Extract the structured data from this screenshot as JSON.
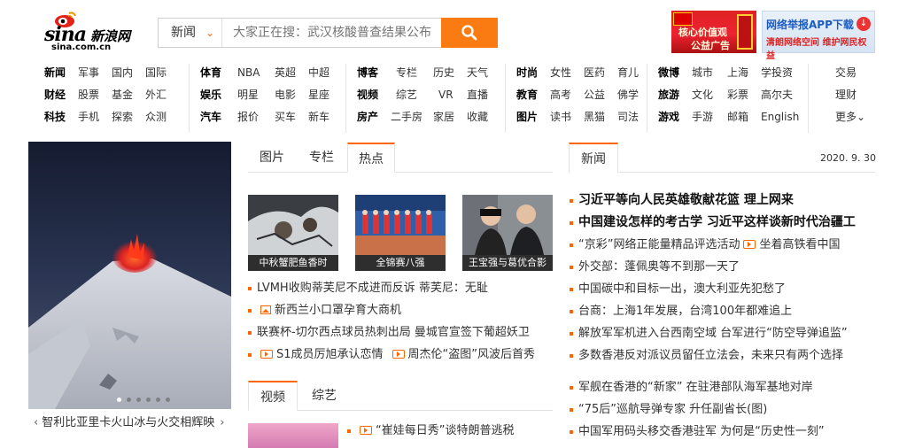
{
  "header": {
    "logo_text": "sina",
    "logo_cn": "新浪网",
    "logo_domain": "sina.com.cn",
    "search_category": "新闻",
    "search_placeholder": "大家正在搜：武汉核酸普查结果公布",
    "ad1_line1": "核心价值观",
    "ad1_line2": "公益广告",
    "ad2_line1": "网络举报APP下载",
    "ad2_line2": "清朗网络空间  维护网民权益"
  },
  "nav": [
    {
      "rows": [
        [
          "新闻",
          "军事",
          "国内",
          "国际"
        ],
        [
          "财经",
          "股票",
          "基金",
          "外汇"
        ],
        [
          "科技",
          "手机",
          "探索",
          "众测"
        ]
      ]
    },
    {
      "rows": [
        [
          "体育",
          "NBA",
          "英超",
          "中超"
        ],
        [
          "娱乐",
          "明星",
          "电影",
          "星座"
        ],
        [
          "汽车",
          "报价",
          "买车",
          "新车"
        ]
      ]
    },
    {
      "rows": [
        [
          "博客",
          "专栏",
          "历史",
          "天气"
        ],
        [
          "视频",
          "综艺",
          "VR",
          "直播"
        ],
        [
          "房产",
          "二手房",
          "家居",
          "收藏"
        ]
      ]
    },
    {
      "rows": [
        [
          "时尚",
          "女性",
          "医药",
          "育儿"
        ],
        [
          "教育",
          "高考",
          "公益",
          "佛学"
        ],
        [
          "图片",
          "读书",
          "黑猫",
          "司法"
        ]
      ]
    },
    {
      "rows": [
        [
          "微博",
          "城市",
          "上海",
          "学投资"
        ],
        [
          "旅游",
          "文化",
          "彩票",
          "高尔夫"
        ],
        [
          "游戏",
          "手游",
          "邮箱",
          "English"
        ]
      ]
    },
    {
      "rows": [
        [
          "交易"
        ],
        [
          "理财"
        ],
        [
          "更多"
        ]
      ]
    }
  ],
  "slideshow": {
    "caption": "智利比亚里卡火山冰与火交相辉映",
    "prev": "‹",
    "next": "›"
  },
  "photo_tabs": [
    "图片",
    "专栏",
    "热点"
  ],
  "photo_thumbs": [
    {
      "label": "中秋蟹肥鱼香时"
    },
    {
      "label": "全锦赛八强"
    },
    {
      "label": "王宝强与葛优合影"
    }
  ],
  "photo_list": [
    {
      "text": "LVMH收购蒂芙尼不成进而反诉 蒂芙尼：无耻"
    },
    {
      "text": "新西兰小口罩孕育大商机",
      "icon": "image"
    },
    {
      "text": "联赛杯-切尔西点球员热刺出局 曼城官宣签下葡超妖卫"
    },
    {
      "text": "S1成员厉旭承认恋情",
      "icon": "video",
      "text2": "周杰伦“盗图”风波后首秀",
      "icon2": "video"
    }
  ],
  "video_tabs": [
    "视频",
    "综艺"
  ],
  "video_list": [
    {
      "text": "“崔娃每日秀”谈特朗普逃税",
      "icon": "video"
    }
  ],
  "news": {
    "tab": "新闻",
    "date": "2020. 9. 30",
    "headlines": [
      {
        "text": "习近平等向人民英雄敬献花篮  理上网来",
        "bold": true
      },
      {
        "text": "中国建设怎样的考古学 习近平这样谈新时代治疆工",
        "bold": true
      },
      {
        "text": "“京彩”网络正能量精品评选活动",
        "icon": "video",
        "text2": "坐着高铁看中国"
      },
      {
        "text": "外交部：蓬佩奥等不到那一天了"
      },
      {
        "text": "中国碳中和目标一出，澳大利亚先犯愁了"
      },
      {
        "text": "台商：上海1年发展，台湾100年都难追上"
      },
      {
        "text": "解放军军机进入台西南空域 台军进行“防空导弹追监”"
      },
      {
        "text": "多数香港反对派议员留任立法会，未来只有两个选择"
      }
    ],
    "headlines2": [
      {
        "text": "军舰在香港的“新家” 在驻港部队海军基地对岸"
      },
      {
        "text": "“75后”巡航导弹专家 升任副省长(图)"
      },
      {
        "text": "中国军用码头移交香港驻军 为何是“历史性一刻”"
      }
    ]
  },
  "colors": {
    "accent": "#f97b12",
    "link": "#333333"
  }
}
